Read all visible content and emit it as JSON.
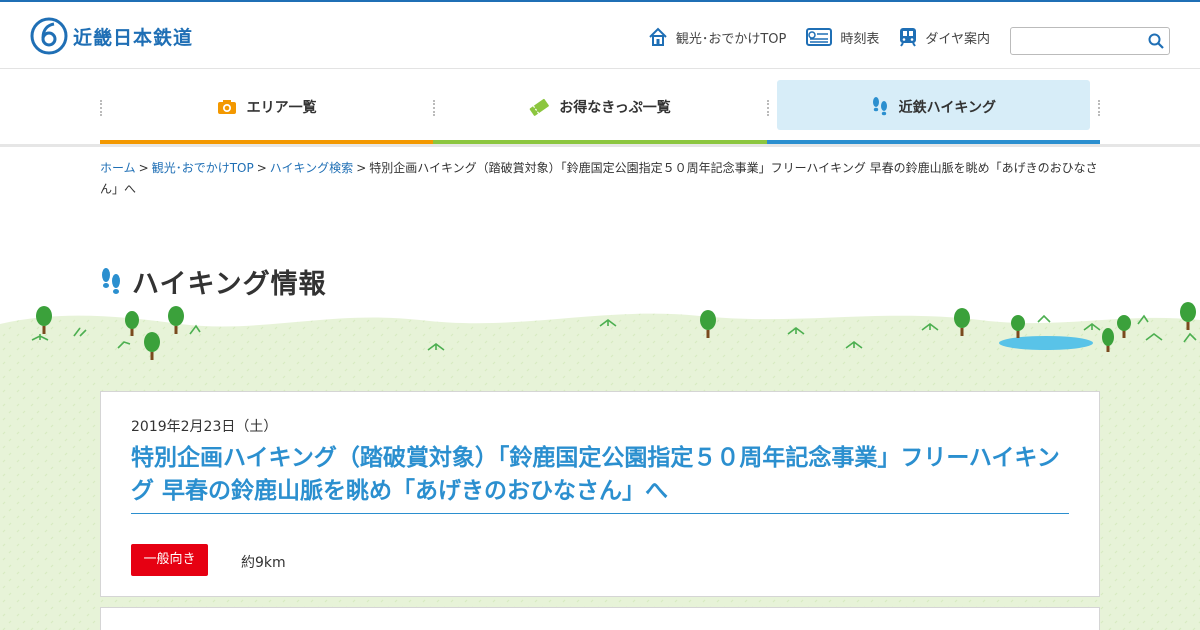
{
  "header": {
    "logo_text": "近畿日本鉄道",
    "nav": [
      {
        "label": "観光･おでかけTOP",
        "icon": "home-icon"
      },
      {
        "label": "時刻表",
        "icon": "timetable-icon"
      },
      {
        "label": "ダイヤ案内",
        "icon": "train-icon"
      }
    ],
    "search": {
      "value": "",
      "placeholder": ""
    }
  },
  "gnav": {
    "items": [
      {
        "label": "エリア一覧",
        "icon": "camera-icon",
        "color": "#f39800"
      },
      {
        "label": "お得なきっぷ一覧",
        "icon": "ticket-icon",
        "color": "#8cc63f"
      },
      {
        "label": "近鉄ハイキング",
        "icon": "footprints-icon",
        "color": "#2b8fcf",
        "active": true
      }
    ]
  },
  "breadcrumb": {
    "links": [
      "ホーム",
      "観光･おでかけTOP",
      "ハイキング検索"
    ],
    "current": "特別企画ハイキング（踏破賞対象）「鈴鹿国定公園指定５０周年記念事業」フリーハイキング 早春の鈴鹿山脈を眺め「あげきのおひなさん」へ",
    "separator": ">"
  },
  "page": {
    "heading": "ハイキング情報"
  },
  "event": {
    "date": "2019年2月23日（土）",
    "title": "特別企画ハイキング（踏破賞対象）「鈴鹿国定公園指定５０周年記念事業」フリーハイキング 早春の鈴鹿山脈を眺め「あげきのおひなさん」へ",
    "level_badge": "一般向き",
    "distance": "約9km"
  },
  "colors": {
    "brand_blue": "#1f6fb5",
    "title_blue": "#2b8fcf",
    "badge_red": "#e60012",
    "grass": "#e6f3d6"
  }
}
